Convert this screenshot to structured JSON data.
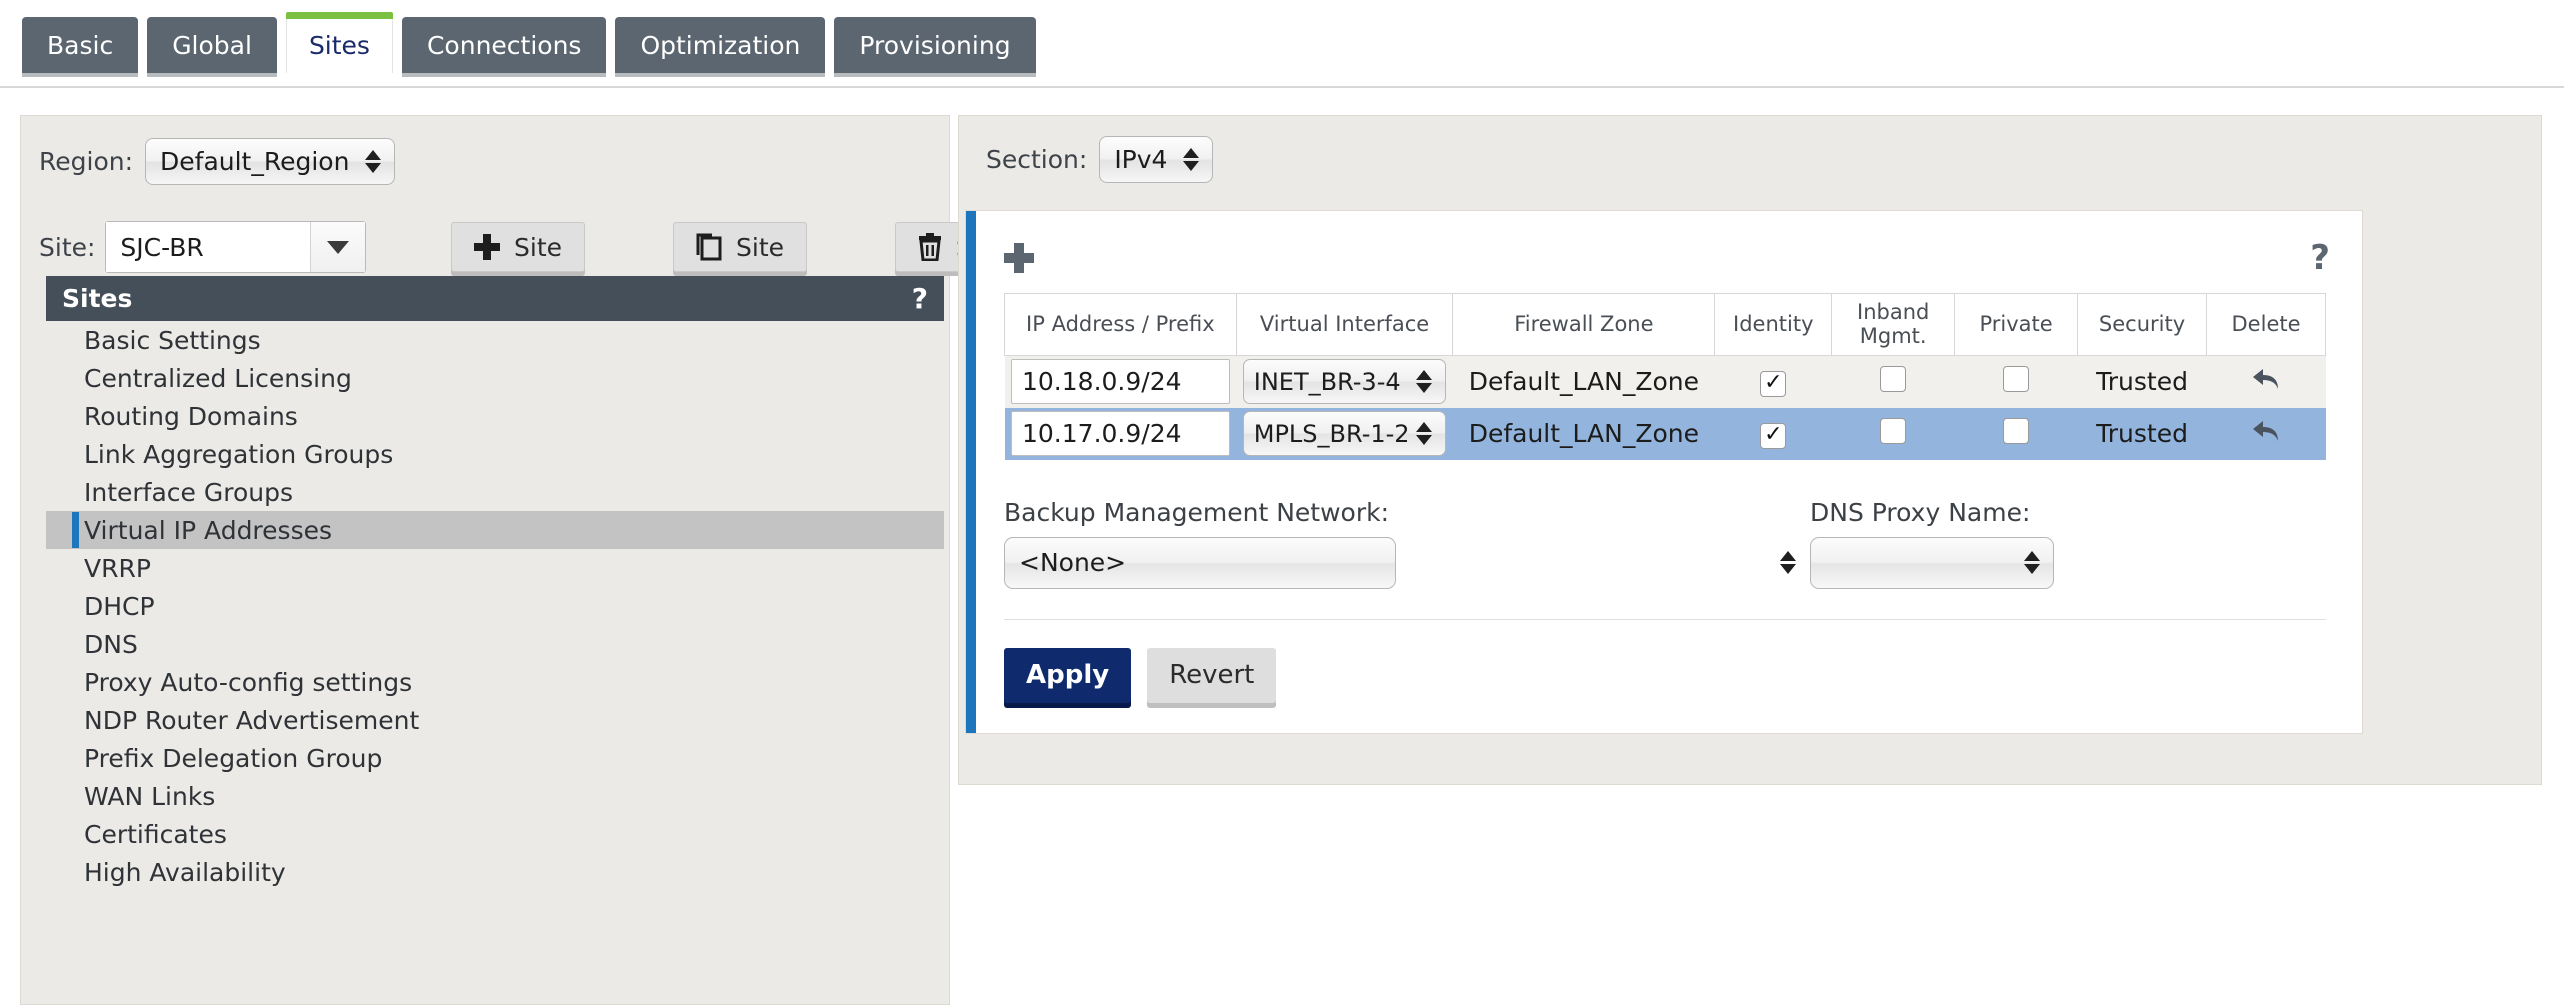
{
  "tabs": [
    {
      "label": "Basic",
      "active": false
    },
    {
      "label": "Global",
      "active": false
    },
    {
      "label": "Sites",
      "active": true
    },
    {
      "label": "Connections",
      "active": false
    },
    {
      "label": "Optimization",
      "active": false
    },
    {
      "label": "Provisioning",
      "active": false
    }
  ],
  "left": {
    "region": {
      "label": "Region:",
      "value": "Default_Region"
    },
    "site": {
      "label": "Site:",
      "value": "SJC-BR"
    },
    "toolbar": [
      {
        "icon": "plus-icon",
        "label": "Site"
      },
      {
        "icon": "copy-icon",
        "label": "Site"
      },
      {
        "icon": "trash-icon",
        "label": "Site"
      }
    ],
    "list_header": {
      "title": "Sites",
      "help": "?"
    },
    "items": [
      {
        "label": "Basic Settings",
        "selected": false
      },
      {
        "label": "Centralized Licensing",
        "selected": false
      },
      {
        "label": "Routing Domains",
        "selected": false
      },
      {
        "label": "Link Aggregation Groups",
        "selected": false
      },
      {
        "label": "Interface Groups",
        "selected": false
      },
      {
        "label": "Virtual IP Addresses",
        "selected": true
      },
      {
        "label": "VRRP",
        "selected": false
      },
      {
        "label": "DHCP",
        "selected": false
      },
      {
        "label": "DNS",
        "selected": false
      },
      {
        "label": "Proxy Auto-config settings",
        "selected": false
      },
      {
        "label": "NDP Router Advertisement",
        "selected": false
      },
      {
        "label": "Prefix Delegation Group",
        "selected": false
      },
      {
        "label": "WAN Links",
        "selected": false
      },
      {
        "label": "Certificates",
        "selected": false
      },
      {
        "label": "High Availability",
        "selected": false
      }
    ]
  },
  "right": {
    "section": {
      "label": "Section:",
      "value": "IPv4"
    },
    "card": {
      "add_icon": "plus-icon",
      "help_icon": "question-mark-icon",
      "accent_color": "#1d75bc",
      "table": {
        "headers": [
          "IP Address / Prefix",
          "Virtual Interface",
          "Firewall Zone",
          "Identity",
          "Inband Mgmt.",
          "Private",
          "Security",
          "Delete"
        ],
        "header_inband_line1": "Inband",
        "header_inband_line2": "Mgmt.",
        "rows": [
          {
            "ip": "10.18.0.9/24",
            "virtual_interface": "INET_BR-3-4",
            "firewall_zone": "Default_LAN_Zone",
            "identity": true,
            "inband_mgmt": false,
            "private": false,
            "security": "Trusted",
            "delete_icon": "undo-arrow-icon",
            "highlighted": false
          },
          {
            "ip": "10.17.0.9/24",
            "virtual_interface": "MPLS_BR-1-2",
            "firewall_zone": "Default_LAN_Zone",
            "identity": true,
            "inband_mgmt": false,
            "private": false,
            "security": "Trusted",
            "delete_icon": "undo-arrow-icon",
            "highlighted": true
          }
        ]
      },
      "backup_mgmt": {
        "label": "Backup Management Network:",
        "value": "<None>"
      },
      "dns_proxy": {
        "label": "DNS Proxy Name:",
        "value": ""
      },
      "apply_label": "Apply",
      "revert_label": "Revert"
    }
  }
}
